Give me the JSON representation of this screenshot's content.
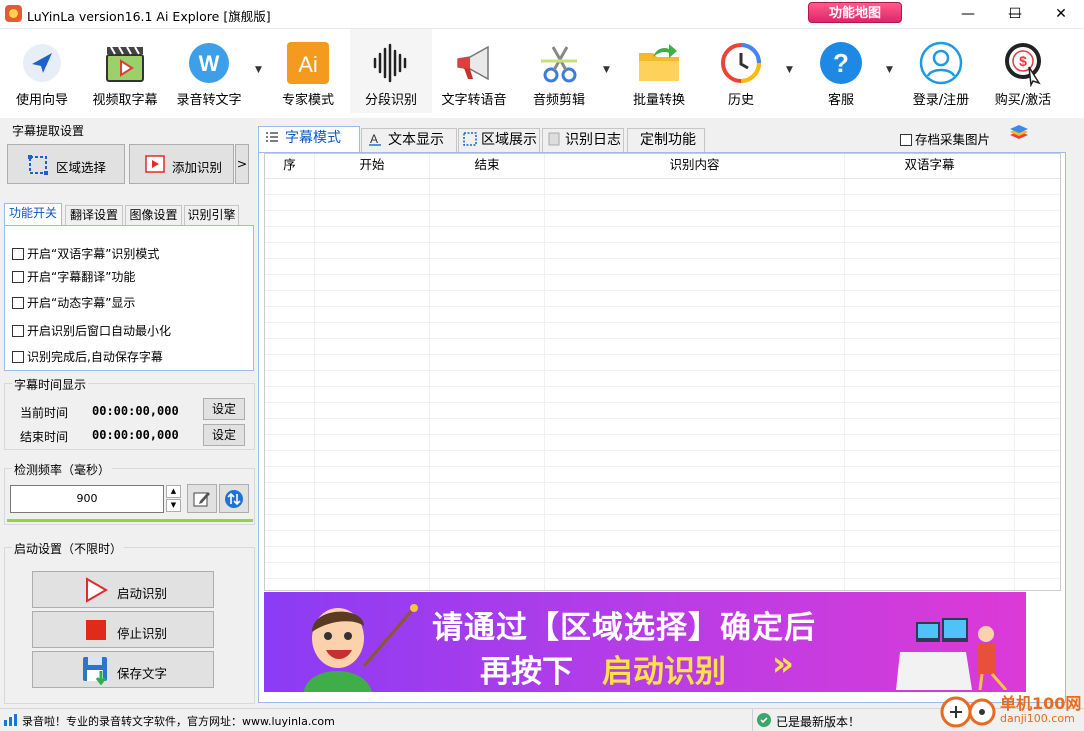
{
  "window": {
    "title": "LuYinLa version16.1 Ai Explore [旗舰版]",
    "feature_map": "功能地图"
  },
  "toolbar": [
    {
      "label": "使用向导",
      "icon": "navigation-arrow-icon"
    },
    {
      "label": "视频取字幕",
      "icon": "video-clapperboard-icon"
    },
    {
      "label": "录音转文字",
      "icon": "w-badge-icon",
      "dropdown": true
    },
    {
      "label": "专家模式",
      "icon": "ai-square-icon"
    },
    {
      "label": "分段识别",
      "icon": "waveform-icon"
    },
    {
      "label": "文字转语音",
      "icon": "megaphone-icon"
    },
    {
      "label": "音频剪辑",
      "icon": "scissors-icon",
      "dropdown": true
    },
    {
      "label": "批量转换",
      "icon": "folder-arrow-icon"
    },
    {
      "label": "历史",
      "icon": "history-clock-icon",
      "dropdown": true
    },
    {
      "label": "客服",
      "icon": "help-question-icon",
      "dropdown": true
    },
    {
      "label": "登录/注册",
      "icon": "user-circle-icon"
    },
    {
      "label": "购买/激活",
      "icon": "dollar-coin-icon"
    }
  ],
  "left": {
    "extract_title": "字幕提取设置",
    "region_select": "区域选择",
    "add_recognize": "添加识别",
    "more": ">",
    "tabs": [
      "功能开关",
      "翻译设置",
      "图像设置",
      "识别引擎"
    ],
    "options": [
      "开启“双语字幕”识别模式",
      "开启“字幕翻译”功能",
      "开启“动态字幕”显示",
      "开启识别后窗口自动最小化",
      "识别完成后,自动保存字幕"
    ],
    "time_title": "字幕时间显示",
    "current_time_label": "当前时间",
    "current_time": "00:00:00,000",
    "end_time_label": "结束时间",
    "end_time": "00:00:00,000",
    "set_label": "设定",
    "freq_title": "检测频率（毫秒）",
    "freq_value": "900",
    "start_title": "启动设置（不限时）",
    "start_btn": "启动识别",
    "stop_btn": "停止识别",
    "save_btn": "保存文字"
  },
  "main": {
    "tabs": [
      "字幕模式",
      "文本显示",
      "区域展示",
      "识别日志",
      "定制功能"
    ],
    "archive_label": "存档采集图片",
    "columns": [
      "序",
      "开始",
      "结束",
      "识别内容",
      "双语字幕"
    ],
    "banner_line1": "请通过【区域选择】确定后",
    "banner_line2a": "再按下",
    "banner_line2b": "启动识别",
    "banner_arrow": "»"
  },
  "status": {
    "left": "录音啦！专业的录音转文字软件，官方网址：www.luyinla.com",
    "right": "已是最新版本！"
  },
  "watermark": {
    "line1": "单机100网",
    "line2": "danji100.com"
  }
}
